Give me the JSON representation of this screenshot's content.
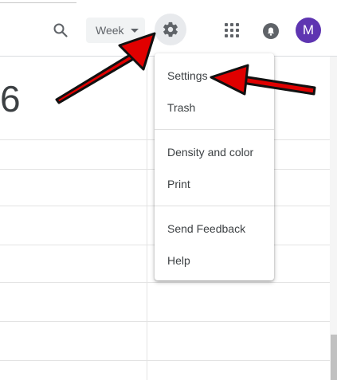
{
  "header": {
    "view_select_value": "Week",
    "avatar_initial": "M"
  },
  "main": {
    "date_number": "6"
  },
  "settings_menu": {
    "items": [
      {
        "label": "Settings"
      },
      {
        "label": "Trash"
      },
      {
        "label": "Density and color"
      },
      {
        "label": "Print"
      },
      {
        "label": "Send Feedback"
      },
      {
        "label": "Help"
      }
    ]
  },
  "colors": {
    "avatar_bg": "#5e35b1",
    "annotation_arrow": "#e00000"
  },
  "icons": [
    "search-icon",
    "chevron-down-icon",
    "gear-icon",
    "apps-grid-icon",
    "notifications-icon"
  ]
}
